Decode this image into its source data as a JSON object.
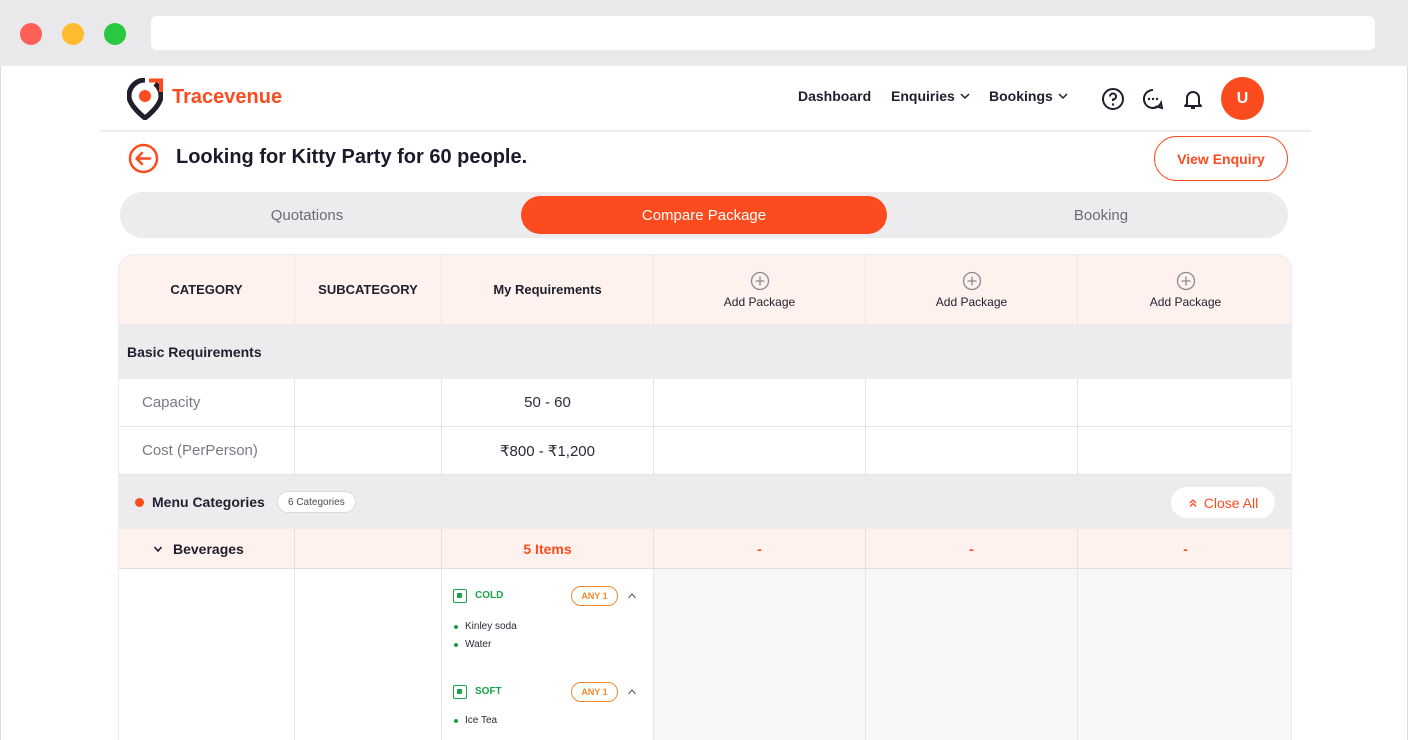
{
  "header": {
    "brand": "Tracevenue",
    "nav": [
      "Dashboard",
      "Enquiries",
      "Bookings"
    ],
    "avatar_initial": "U"
  },
  "page": {
    "title": "Looking for Kitty Party for 60 people.",
    "view_enquiry_label": "View Enquiry"
  },
  "tabs": [
    "Quotations",
    "Compare Package",
    "Booking"
  ],
  "active_tab": "Compare Package",
  "table": {
    "columns": [
      "CATEGORY",
      "SUBCATEGORY",
      "My Requirements"
    ],
    "add_package_label": "Add Package",
    "section_title": "Basic Requirements",
    "rows": [
      {
        "label": "Capacity",
        "value": "50 - 60"
      },
      {
        "label": "Cost (PerPerson)",
        "value": "₹800 - ₹1,200"
      }
    ],
    "menu": {
      "label": "Menu Categories",
      "badge": "6 Categories",
      "close_all": "Close All"
    },
    "beverages": {
      "label": "Beverages",
      "items_count": "5 Items",
      "dash": "-"
    },
    "groups": [
      {
        "name": "COLD",
        "rule": "ANY 1",
        "items": [
          "Kinley soda",
          "Water"
        ]
      },
      {
        "name": "SOFT",
        "rule": "ANY 1",
        "items": [
          "Ice Tea"
        ]
      }
    ]
  },
  "colors": {
    "accent": "#fc4c1f",
    "veg": "#17a34a",
    "rule": "#f08a2e"
  }
}
